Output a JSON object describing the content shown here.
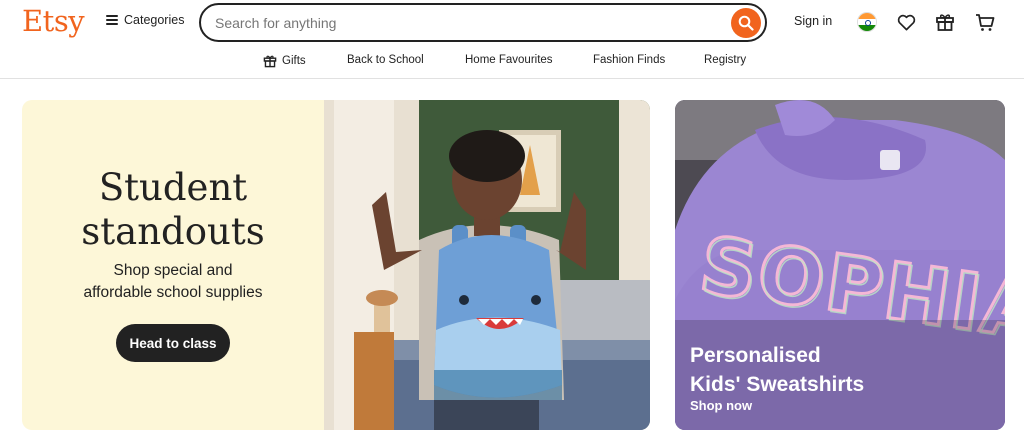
{
  "header": {
    "logo": "Etsy",
    "categories_label": "Categories",
    "search_placeholder": "Search for anything",
    "search_value": "",
    "signin_label": "Sign in",
    "icons": [
      "menu-icon",
      "search-icon",
      "india-flag-icon",
      "heart-icon",
      "gift-icon",
      "cart-icon"
    ]
  },
  "subnav": {
    "items": [
      {
        "label": "Gifts",
        "icon": "gift-icon"
      },
      {
        "label": "Back to School"
      },
      {
        "label": "Home Favourites"
      },
      {
        "label": "Fashion Finds"
      },
      {
        "label": "Registry"
      }
    ]
  },
  "hero": {
    "title_line1": "Student",
    "title_line2": "standouts",
    "subtitle_line1": "Shop special and",
    "subtitle_line2": "affordable school supplies",
    "button_label": "Head to class",
    "background_color": "#FDF7D8"
  },
  "promo": {
    "title_line1": "Personalised",
    "title_line2": "Kids' Sweatshirts",
    "link_label": "Shop now",
    "sweatshirt_text": "SOPHIA"
  },
  "colors": {
    "brand": "#F1641E",
    "text": "#222222",
    "button_bg": "#222222"
  }
}
